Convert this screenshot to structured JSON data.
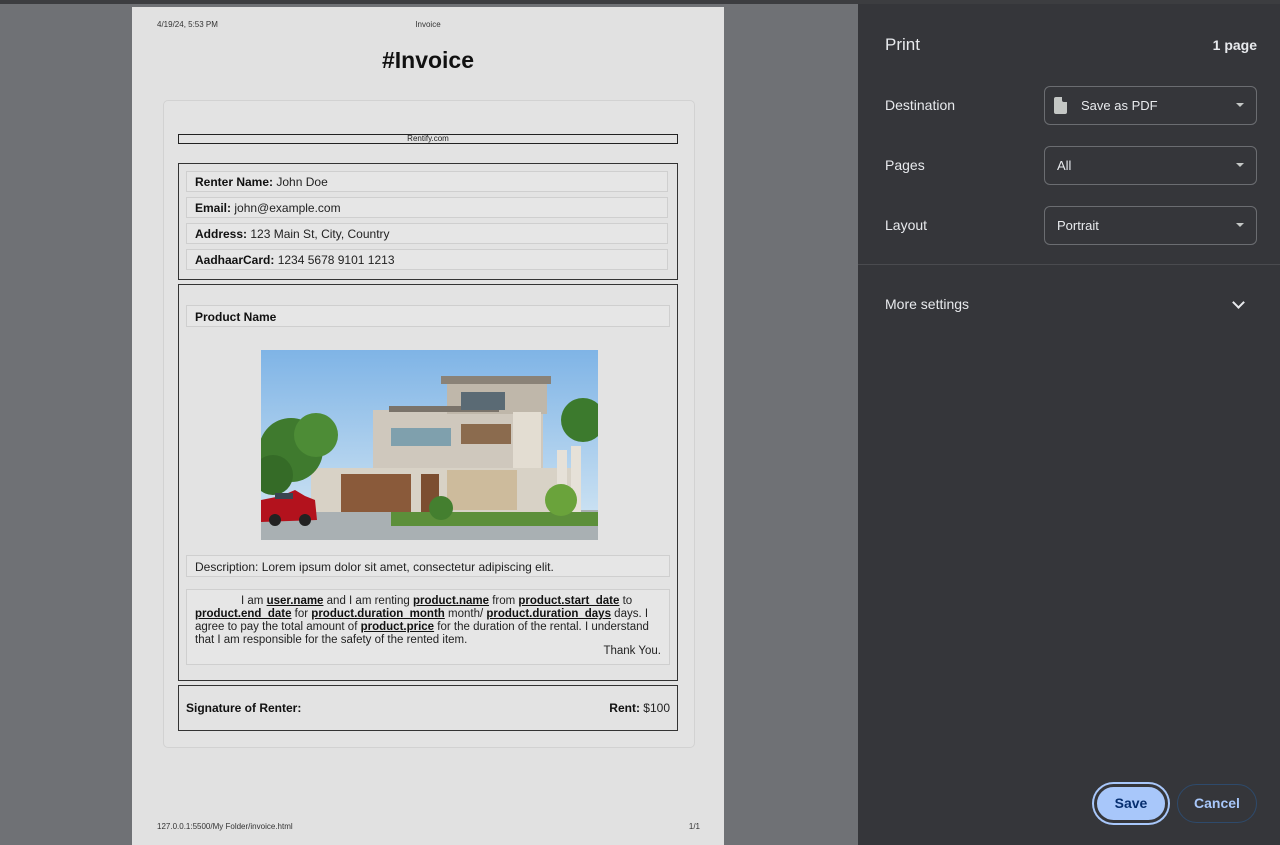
{
  "preview": {
    "header_date": "4/19/24, 5:53 PM",
    "header_title": "Invoice",
    "footer_url": "127.0.0.1:5500/My Folder/invoice.html",
    "footer_page": "1/1",
    "doc_title": "#Invoice",
    "brand": "Rentify.com",
    "renter": {
      "name_label": "Renter Name:",
      "name_value": "John Doe",
      "email_label": "Email:",
      "email_value": "john@example.com",
      "address_label": "Address:",
      "address_value": "123 Main St, City, Country",
      "aadhaar_label": "AadhaarCard:",
      "aadhaar_value": "1234 5678 9101 1213"
    },
    "product": {
      "name_label": "Product Name",
      "description": "Description: Lorem ipsum dolor sit amet, consectetur adipiscing elit.",
      "agreement": {
        "t1": "I am ",
        "user_name": "user.name",
        "t2": " and I am renting ",
        "product_name": "product.name",
        "t3": " from ",
        "start_date": "product.start_date",
        "t4": " to ",
        "end_date": "product.end_date",
        "t5": " for ",
        "duration_month": "product.duration_month",
        "t6": " month/ ",
        "duration_days": "product.duration_days",
        "t7": " days. I agree to pay the total amount of ",
        "price": "product.price",
        "t8": " for the duration of the rental. I understand that I am responsible for the safety of the rented item.",
        "thanks": "Thank You."
      }
    },
    "signature_label": "Signature of Renter:",
    "rent_label": "Rent:",
    "rent_value": "$100"
  },
  "panel": {
    "title": "Print",
    "page_count": "1 page",
    "destination_label": "Destination",
    "destination_value": "Save as PDF",
    "pages_label": "Pages",
    "pages_value": "All",
    "layout_label": "Layout",
    "layout_value": "Portrait",
    "more_settings": "More settings",
    "save": "Save",
    "cancel": "Cancel"
  }
}
